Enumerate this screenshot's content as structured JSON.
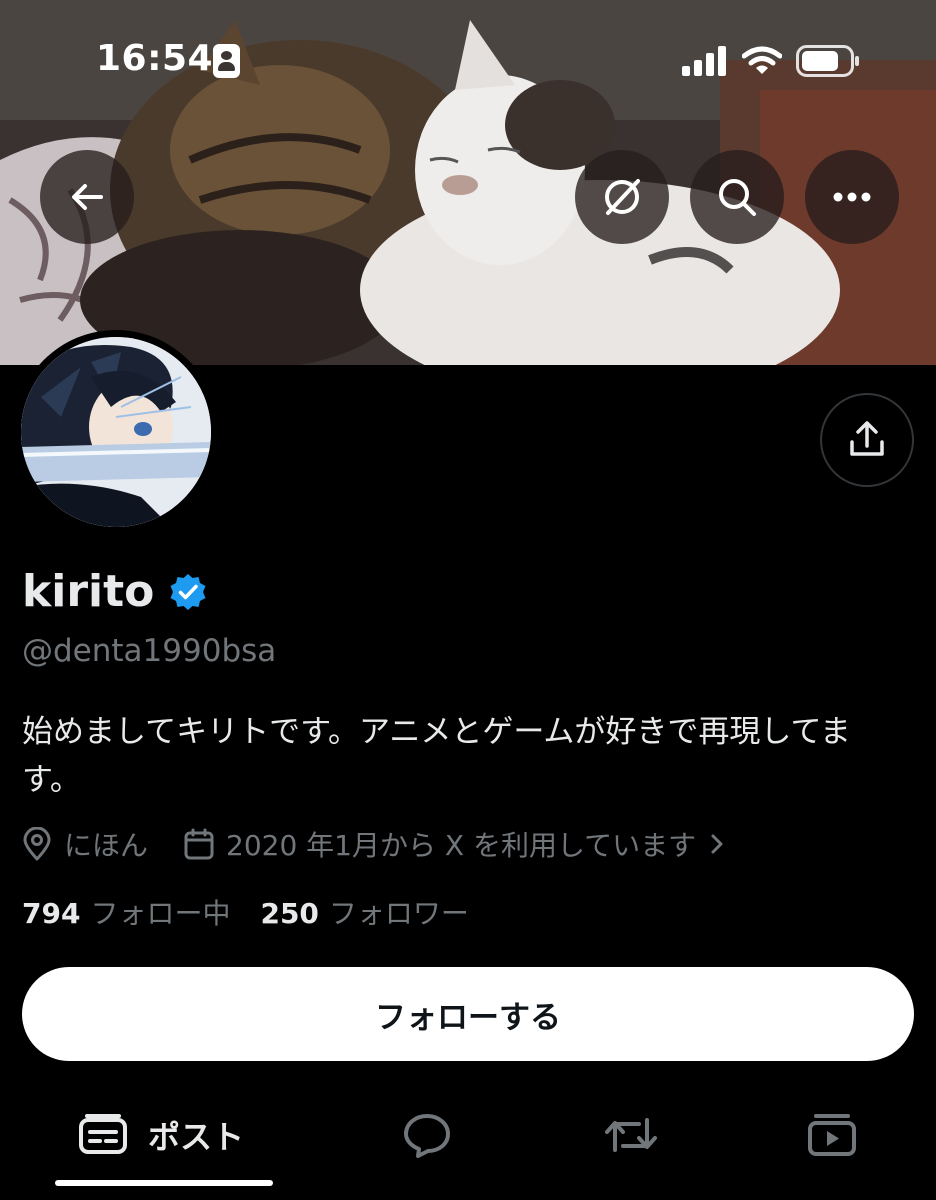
{
  "status_bar": {
    "time": "16:54"
  },
  "banner": {
    "icons": [
      "back-arrow-icon",
      "grok-icon",
      "search-icon",
      "more-icon"
    ]
  },
  "profile": {
    "display_name": "kirito",
    "verified": true,
    "verified_color": "#1d9bf0",
    "handle": "@denta1990bsa",
    "bio": "始めましてキリトです。アニメとゲームが好きで再現してます。",
    "location": "にほん",
    "joined": "2020 年1月から X を利用しています",
    "following_count": "794",
    "following_label": "フォロー中",
    "followers_count": "250",
    "followers_label": "フォロワー",
    "follow_button": "フォローする"
  },
  "tabs": {
    "posts_label": "ポスト",
    "active": "posts"
  },
  "colors": {
    "background": "#000000",
    "primary_text": "#e7e9ea",
    "secondary_text": "#71767b",
    "accent": "#1d9bf0"
  }
}
